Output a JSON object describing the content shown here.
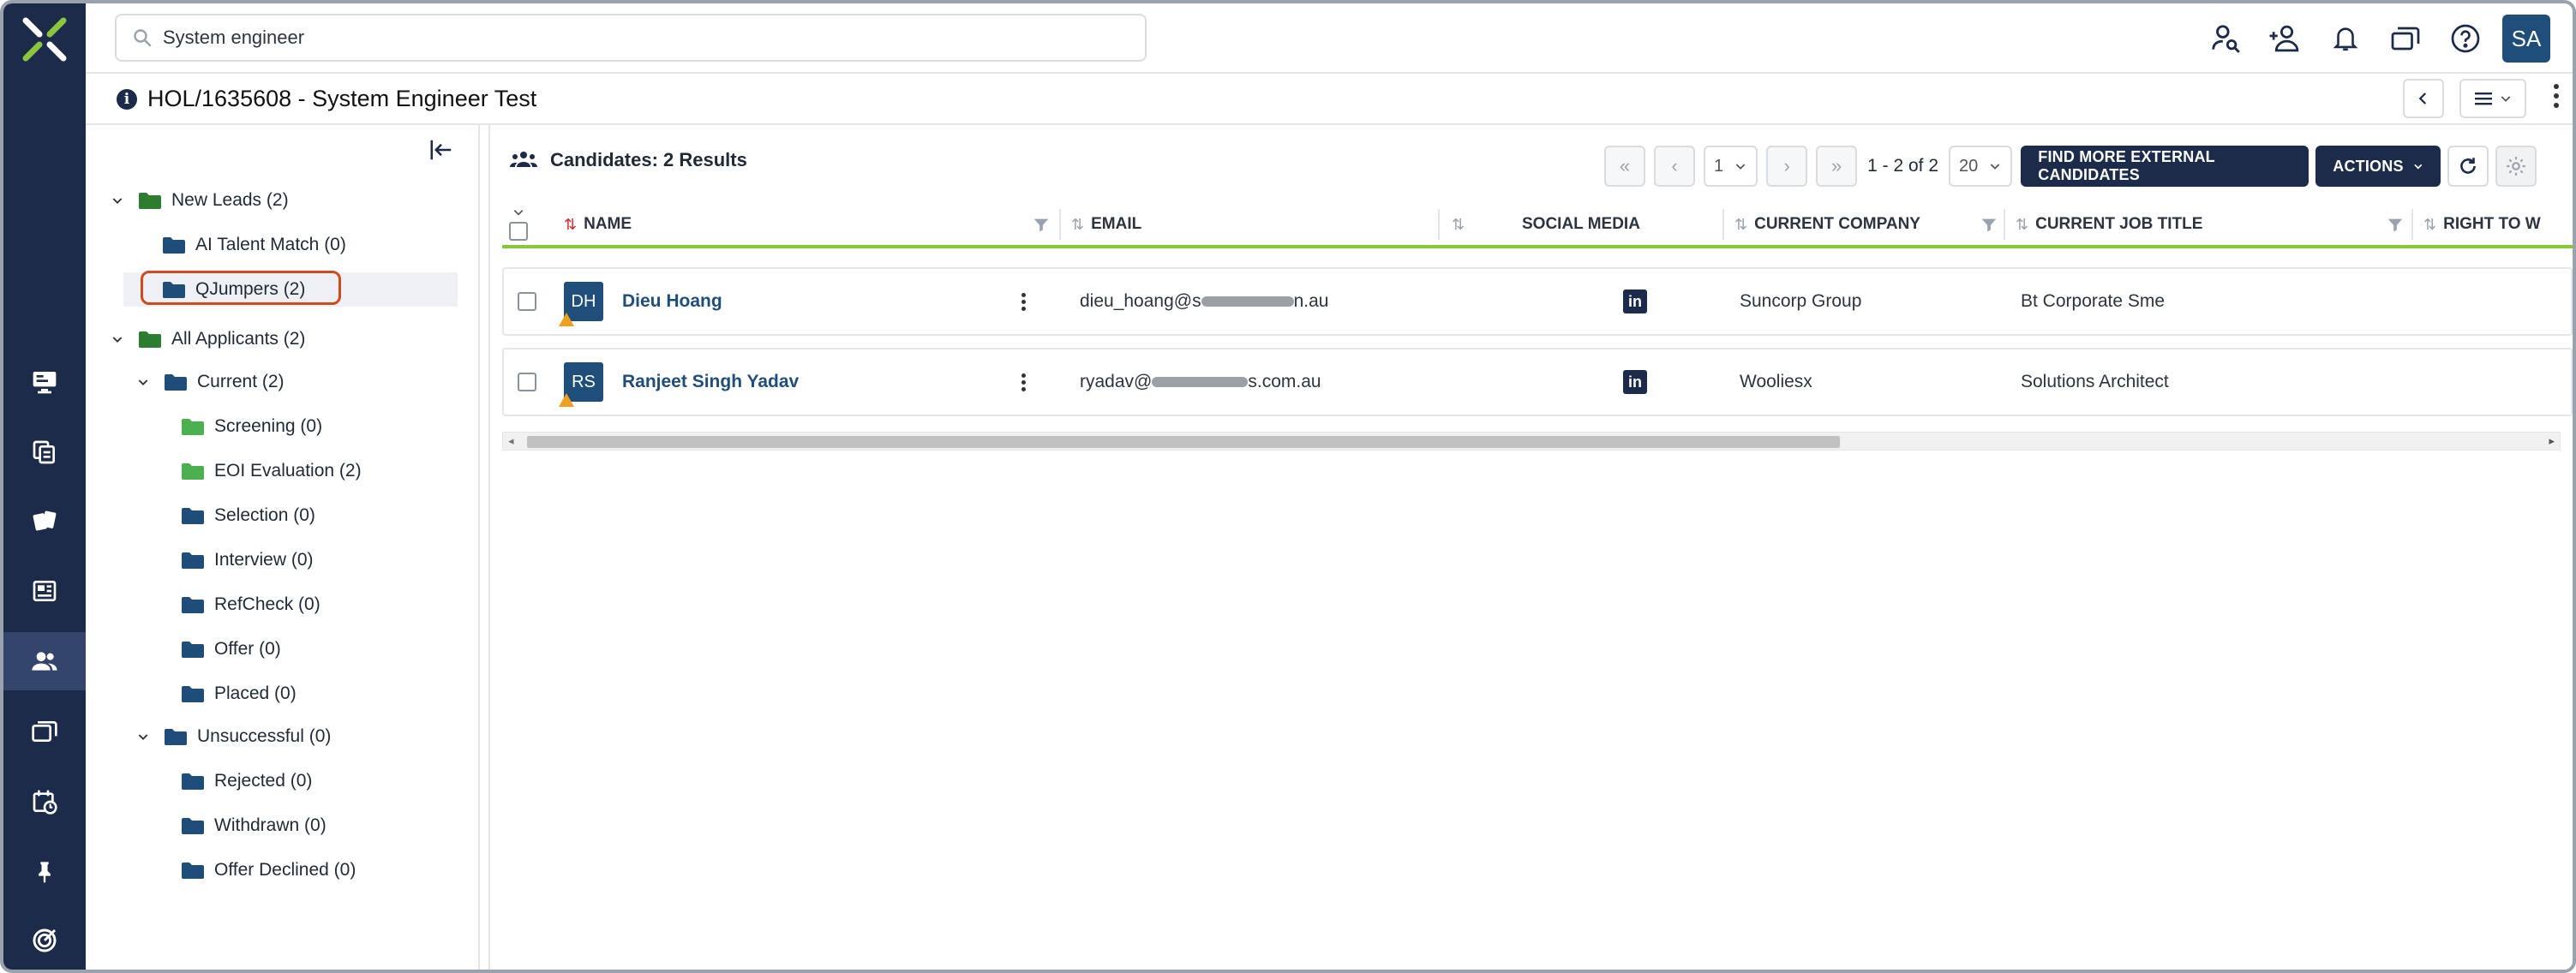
{
  "search": {
    "value": "System engineer"
  },
  "user": {
    "initials": "SA"
  },
  "job": {
    "title": "HOL/1635608 - System Engineer Test"
  },
  "tree": [
    {
      "label": "New Leads (2)",
      "level": 0,
      "chevron": true,
      "folder_color": "#2e7d32"
    },
    {
      "label": "AI Talent Match (0)",
      "level": 1,
      "chevron": false,
      "folder_color": "#1f4e7a"
    },
    {
      "label": "QJumpers (2)",
      "level": 1,
      "chevron": false,
      "folder_color": "#1f4e7a",
      "selected": true
    },
    {
      "label": "All Applicants (2)",
      "level": 0,
      "chevron": true,
      "folder_color": "#2e7d32"
    },
    {
      "label": "Current (2)",
      "level": 1,
      "chevron": true,
      "folder_color": "#1f4e7a"
    },
    {
      "label": "Screening (0)",
      "level": 2,
      "chevron": false,
      "folder_color": "#4caf50"
    },
    {
      "label": "EOI Evaluation (2)",
      "level": 2,
      "chevron": false,
      "folder_color": "#4caf50"
    },
    {
      "label": "Selection (0)",
      "level": 2,
      "chevron": false,
      "folder_color": "#1f4e7a"
    },
    {
      "label": "Interview (0)",
      "level": 2,
      "chevron": false,
      "folder_color": "#1f4e7a"
    },
    {
      "label": "RefCheck (0)",
      "level": 2,
      "chevron": false,
      "folder_color": "#1f4e7a"
    },
    {
      "label": "Offer (0)",
      "level": 2,
      "chevron": false,
      "folder_color": "#1f4e7a"
    },
    {
      "label": "Placed (0)",
      "level": 2,
      "chevron": false,
      "folder_color": "#1f4e7a"
    },
    {
      "label": "Unsuccessful (0)",
      "level": 1,
      "chevron": true,
      "folder_color": "#1f4e7a"
    },
    {
      "label": "Rejected (0)",
      "level": 2,
      "chevron": false,
      "folder_color": "#1f4e7a"
    },
    {
      "label": "Withdrawn (0)",
      "level": 2,
      "chevron": false,
      "folder_color": "#1f4e7a"
    },
    {
      "label": "Offer Declined (0)",
      "level": 2,
      "chevron": false,
      "folder_color": "#1f4e7a"
    }
  ],
  "candidates": {
    "heading": "Candidates: 2 Results",
    "page": "1",
    "range": "1 - 2 of 2",
    "page_size": "20",
    "find_more_label": "FIND MORE EXTERNAL CANDIDATES",
    "actions_label": "ACTIONS"
  },
  "columns": {
    "name": "NAME",
    "email": "EMAIL",
    "social": "SOCIAL MEDIA",
    "company": "CURRENT COMPANY",
    "job_title": "CURRENT JOB TITLE",
    "right_to_work": "RIGHT TO W"
  },
  "rows": [
    {
      "initials": "DH",
      "name": "Dieu Hoang",
      "email_start": "dieu_hoang@s",
      "email_end": "n.au",
      "social_icon": "linkedin-icon",
      "company": "Suncorp Group",
      "job_title": "Bt Corporate Sme"
    },
    {
      "initials": "RS",
      "name": "Ranjeet Singh Yadav",
      "email_start": "ryadav@",
      "email_end": "s.com.au",
      "social_icon": "linkedin-icon",
      "company": "Wooliesx",
      "job_title": "Solutions Architect"
    }
  ],
  "colors": {
    "brand_navy": "#1c2b4a",
    "accent_green": "#8cc63f",
    "highlight_orange": "#cd4b1d"
  }
}
